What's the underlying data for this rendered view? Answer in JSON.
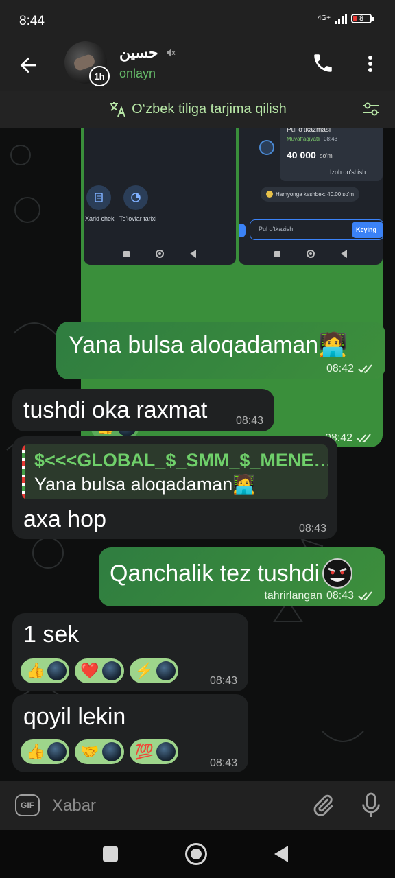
{
  "status_bar": {
    "time": "8:44",
    "network": "4G+",
    "battery": "8"
  },
  "header": {
    "name": "حسين",
    "story_badge": "1h",
    "presence": "onlayn"
  },
  "translate_bar": {
    "label": "O‘zbek tiliga tarjima qilish"
  },
  "media_message": {
    "time": "08:42",
    "left_phone": {
      "button1_label": "Xarid cheki",
      "button2_label": "To'lovlar tarixi"
    },
    "right_phone": {
      "title": "Pul o'tkazmasi",
      "status": "Muvaffaqiyatli",
      "status_time": "08:43",
      "amount": "40 000",
      "currency": "so'm",
      "comment": "Izoh qo'shish",
      "cashback": "Hamyonga keshbek: 40.00 so'm",
      "input_placeholder": "Pul o'tkazish",
      "button_label": "Keying"
    },
    "reaction": {
      "emoji": "👍"
    }
  },
  "messages": [
    {
      "id": "m1",
      "direction": "out",
      "text": "Yana bulsa aloqadaman🧑‍💻",
      "time": "08:42"
    },
    {
      "id": "m2",
      "direction": "in",
      "text": "tushdi oka raxmat",
      "time": "08:43"
    },
    {
      "id": "m3",
      "direction": "in",
      "reply_name": "$<<<GLOBAL_$_SMM_$_MENE…",
      "reply_text": "Yana bulsa aloqadaman🧑‍💻",
      "text": "axa hop",
      "time": "08:43"
    },
    {
      "id": "m4",
      "direction": "out",
      "text": "Qanchalik tez tushdi",
      "edited_label": "tahrirlangan",
      "time": "08:43"
    },
    {
      "id": "m5",
      "direction": "in",
      "text": "1 sek",
      "time": "08:43",
      "reactions": [
        "👍",
        "❤️",
        "⚡"
      ]
    },
    {
      "id": "m6",
      "direction": "in",
      "text": "qoyil lekin",
      "time": "08:43",
      "reactions": [
        "👍",
        "🤝",
        "💯"
      ]
    }
  ],
  "composer": {
    "gif_label": "GIF",
    "placeholder": "Xabar"
  },
  "colors": {
    "accent_green": "#66bb6a",
    "outgoing_bubble": "#3a8f3b",
    "incoming_bubble": "#1f2122",
    "header_bg": "#212121"
  }
}
